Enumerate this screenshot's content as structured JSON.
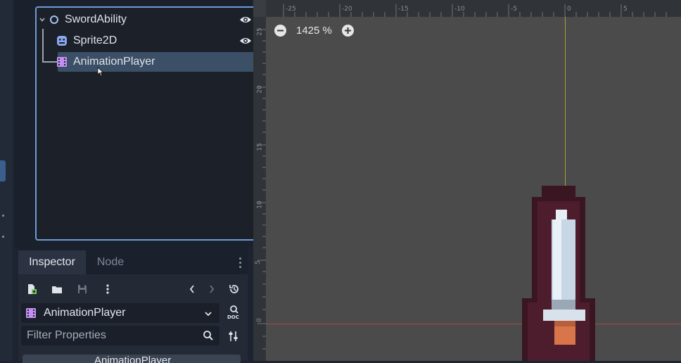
{
  "scene_tree": {
    "nodes": [
      {
        "name": "SwordAbility",
        "icon": "node2d-circle-icon"
      },
      {
        "name": "Sprite2D",
        "icon": "sprite2d-icon"
      },
      {
        "name": "AnimationPlayer",
        "icon": "animation-player-icon"
      }
    ],
    "selected": "AnimationPlayer"
  },
  "inspector": {
    "tabs": [
      "Inspector",
      "Node"
    ],
    "selected_node": "AnimationPlayer",
    "filter_placeholder": "Filter Properties",
    "section_header": "AnimationPlayer",
    "doc_label": "DOC"
  },
  "viewport": {
    "zoom_label": "1425 %",
    "ruler_top_labels": [
      "-25",
      "-20",
      "-15",
      "-10",
      "-5",
      "0",
      "5"
    ],
    "ruler_left_labels": [
      "25",
      "20",
      "15",
      "10",
      "5",
      "0"
    ]
  },
  "colors": {
    "accent": "#6d9bd8",
    "selection": "#3b4f66",
    "viewport_bg": "#4b4b4b",
    "sprite_outline": "#3a1522",
    "blade": "#c8d7e6",
    "handle": "#d9754a"
  }
}
